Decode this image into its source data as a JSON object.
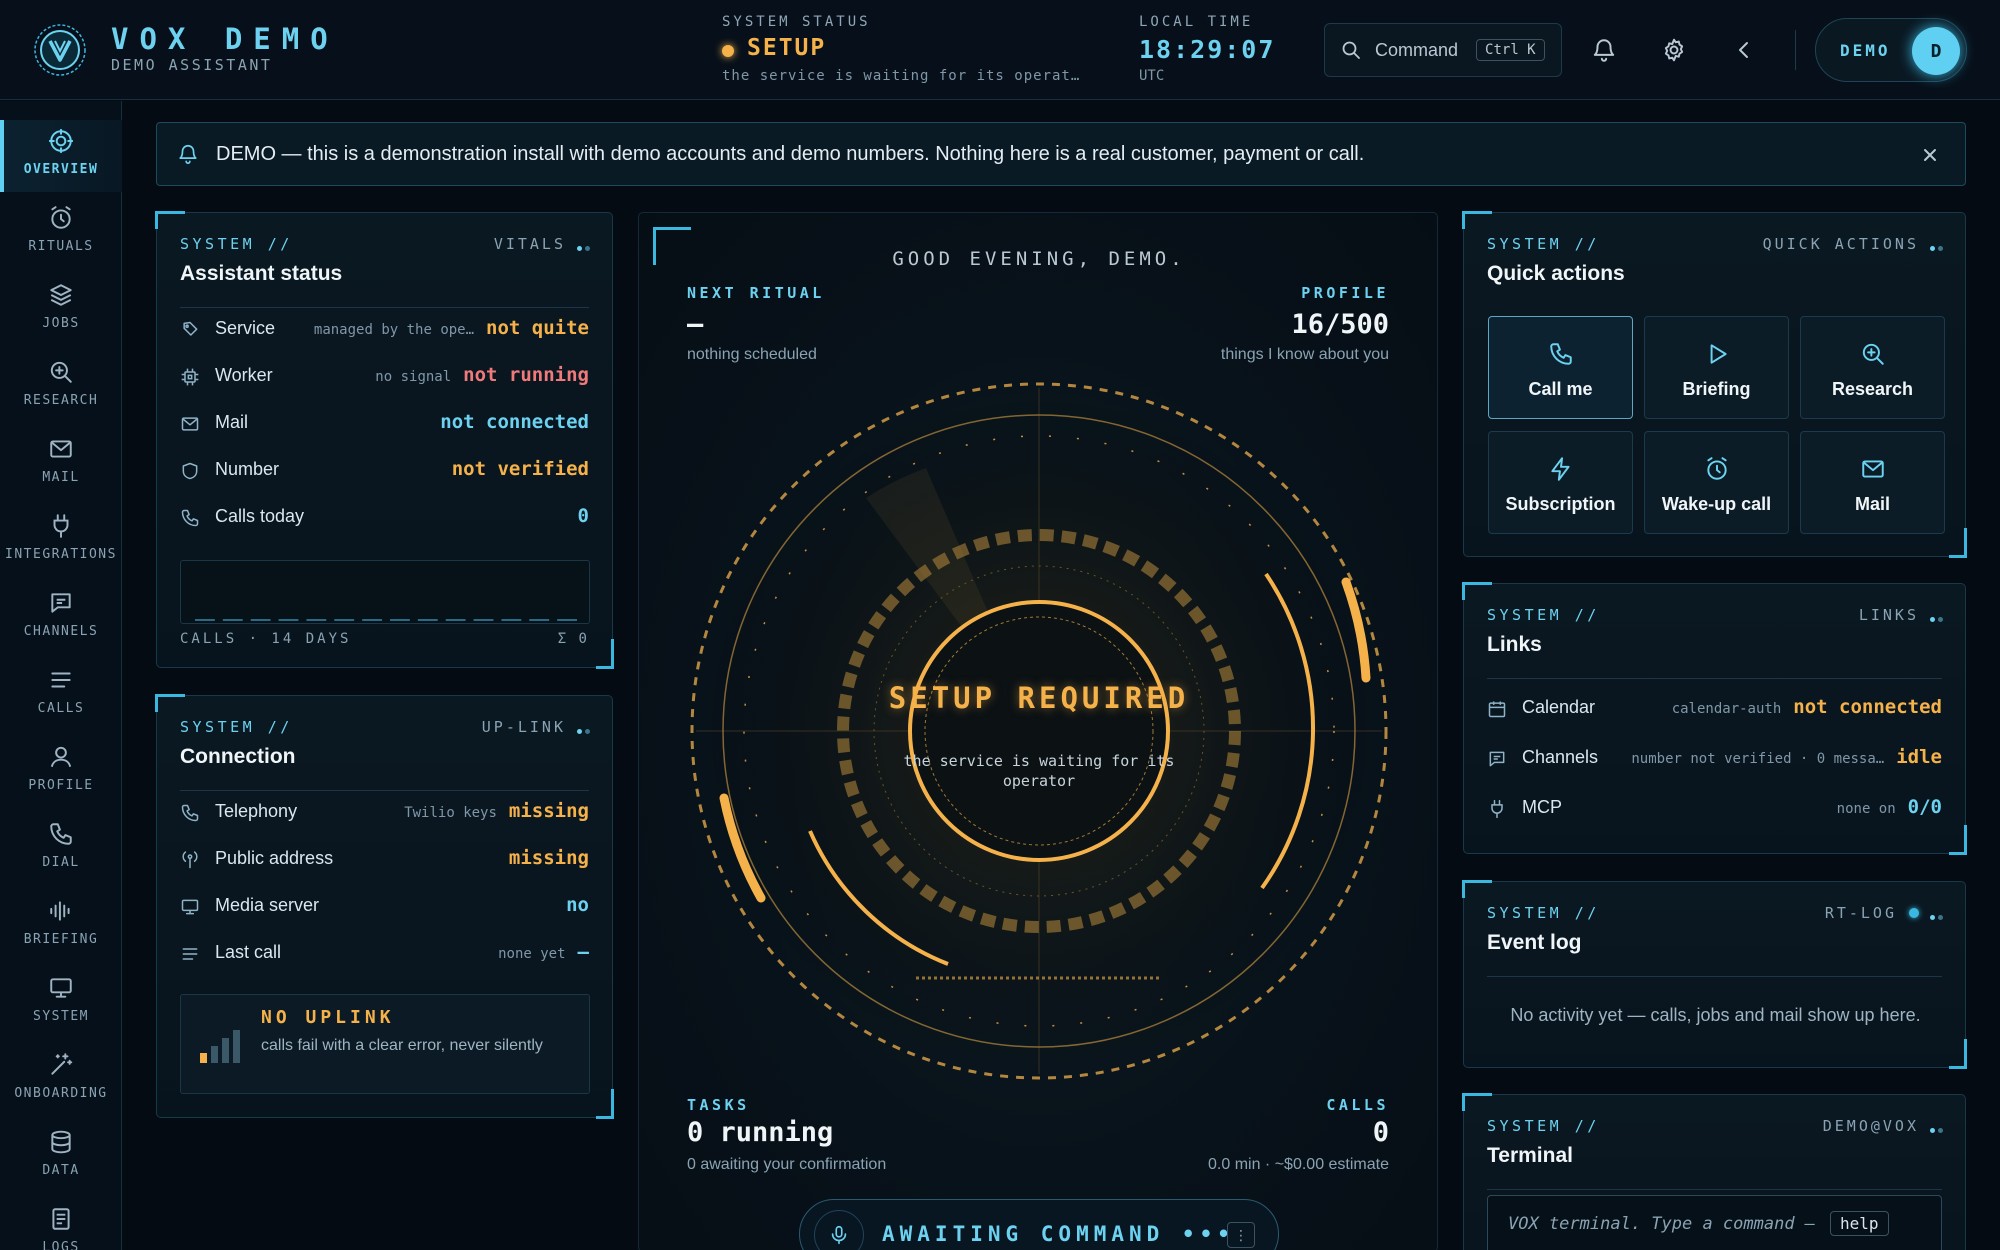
{
  "brand": {
    "title": "VOX DEMO",
    "subtitle": "DEMO ASSISTANT"
  },
  "topbar": {
    "status_label": "SYSTEM STATUS",
    "status_value": "SETUP",
    "status_detail": "the service is waiting for its operat…",
    "time_label": "LOCAL TIME",
    "time_value": "18:29:07",
    "time_zone": "UTC",
    "command_label": "Command",
    "command_shortcut": "Ctrl K",
    "user_name": "DEMO",
    "user_initial": "D"
  },
  "colors": {
    "accent": "#6cd2f0",
    "warning": "#f6b24a",
    "danger": "#f07a7a",
    "background": "#050b12"
  },
  "sidebar": {
    "items": [
      {
        "label": "OVERVIEW",
        "icon": "crosshair-icon",
        "active": true
      },
      {
        "label": "RITUALS",
        "icon": "alarm-clock-icon"
      },
      {
        "label": "JOBS",
        "icon": "layers-icon"
      },
      {
        "label": "RESEARCH",
        "icon": "zoom-in-icon"
      },
      {
        "label": "MAIL",
        "icon": "mail-icon"
      },
      {
        "label": "INTEGRATIONS",
        "icon": "plug-icon"
      },
      {
        "label": "CHANNELS",
        "icon": "message-icon"
      },
      {
        "label": "CALLS",
        "icon": "list-icon"
      },
      {
        "label": "PROFILE",
        "icon": "user-icon"
      },
      {
        "label": "DIAL",
        "icon": "phone-icon"
      },
      {
        "label": "BRIEFING",
        "icon": "waveform-icon"
      },
      {
        "label": "SYSTEM",
        "icon": "monitor-icon"
      },
      {
        "label": "ONBOARDING",
        "icon": "magic-wand-icon"
      },
      {
        "label": "DATA",
        "icon": "database-icon"
      },
      {
        "label": "LOGS",
        "icon": "file-text-icon"
      }
    ]
  },
  "banner": {
    "text": "DEMO — this is a demonstration install with demo accounts and demo numbers. Nothing here is a real customer, payment or call."
  },
  "assistant_status": {
    "kicker": "SYSTEM //",
    "tag": "VITALS",
    "title": "Assistant status",
    "rows": [
      {
        "label": "Service",
        "note": "managed by the ope…",
        "value": "not quite"
      },
      {
        "label": "Worker",
        "note": "no signal",
        "value": "not running"
      },
      {
        "label": "Mail",
        "note": "",
        "value": "not connected"
      },
      {
        "label": "Number",
        "note": "",
        "value": "not verified"
      },
      {
        "label": "Calls today",
        "note": "",
        "value": "0"
      }
    ],
    "calls_chart_label": "CALLS · 14 DAYS",
    "calls_chart_total": "Σ 0",
    "calls_14_days": [
      0,
      0,
      0,
      0,
      0,
      0,
      0,
      0,
      0,
      0,
      0,
      0,
      0,
      0
    ]
  },
  "connection": {
    "kicker": "SYSTEM //",
    "tag": "UP-LINK",
    "title": "Connection",
    "rows": [
      {
        "label": "Telephony",
        "note": "Twilio keys",
        "value": "missing"
      },
      {
        "label": "Public address",
        "note": "",
        "value": "missing"
      },
      {
        "label": "Media server",
        "note": "",
        "value": "no"
      },
      {
        "label": "Last call",
        "note": "none yet",
        "value": "—"
      }
    ],
    "uplink_title": "NO UPLINK",
    "uplink_desc": "calls fail with a clear error, never silently"
  },
  "center": {
    "greeting": "GOOD EVENING, DEMO.",
    "next_ritual_label": "NEXT RITUAL",
    "next_ritual_value": "—",
    "next_ritual_sub": "nothing scheduled",
    "profile_label": "PROFILE",
    "profile_value": "16/500",
    "profile_sub": "things I know about you",
    "hud_title": "SETUP REQUIRED",
    "hud_sub": "the service is waiting for its operator",
    "tasks_label": "TASKS",
    "tasks_value": "0 running",
    "tasks_sub": "0 awaiting your confirmation",
    "calls_label": "CALLS",
    "calls_value": "0",
    "calls_sub": "0.0 min · ~$0.00 estimate",
    "command_text": "AWAITING COMMAND •••",
    "command_menu": "⋮"
  },
  "quick_actions": {
    "kicker": "SYSTEM //",
    "tag": "QUICK ACTIONS",
    "title": "Quick actions",
    "buttons": [
      {
        "label": "Call me",
        "icon": "phone-icon"
      },
      {
        "label": "Briefing",
        "icon": "play-icon"
      },
      {
        "label": "Research",
        "icon": "zoom-in-icon"
      },
      {
        "label": "Subscription",
        "icon": "lightning-icon"
      },
      {
        "label": "Wake-up call",
        "icon": "alarm-clock-icon"
      },
      {
        "label": "Mail",
        "icon": "mail-icon"
      }
    ]
  },
  "links": {
    "kicker": "SYSTEM //",
    "tag": "LINKS",
    "title": "Links",
    "rows": [
      {
        "label": "Calendar",
        "note": "calendar-auth",
        "value": "not connected"
      },
      {
        "label": "Channels",
        "note": "number not verified · 0 messa…",
        "value": "idle"
      },
      {
        "label": "MCP",
        "note": "none on",
        "value": "0/0"
      }
    ]
  },
  "event_log": {
    "kicker": "SYSTEM //",
    "tag": "RT-LOG",
    "title": "Event log",
    "empty_text": "No activity yet — calls, jobs and mail show up here."
  },
  "terminal": {
    "kicker": "SYSTEM //",
    "tag": "DEMO@VOX",
    "title": "Terminal",
    "placeholder": "VOX terminal. Type a command —",
    "help_label": "help"
  }
}
